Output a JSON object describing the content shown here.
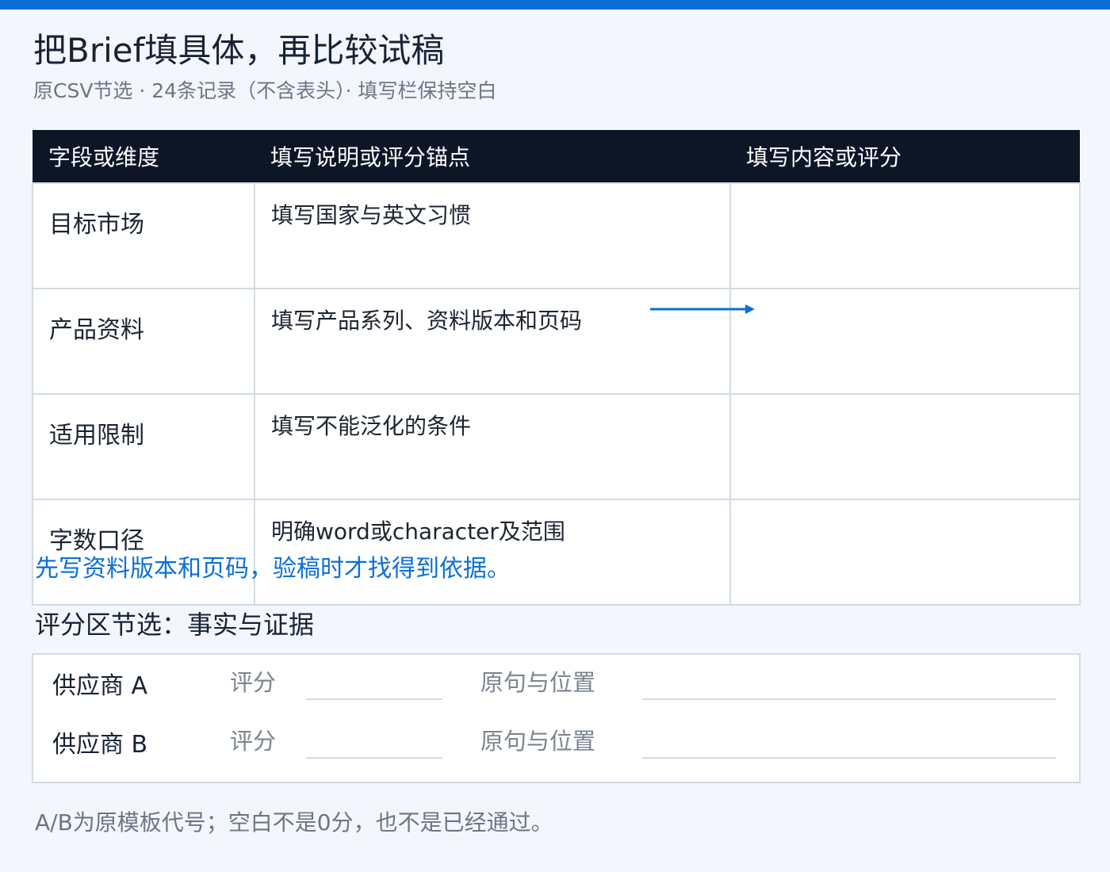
{
  "header": {
    "title": "把Brief填具体，再比较试稿",
    "subtitle": "原CSV节选 · 24条记录（不含表头）· 填写栏保持空白"
  },
  "table": {
    "headers": [
      "字段或维度",
      "填写说明或评分锚点",
      "填写内容或评分"
    ],
    "rows": [
      {
        "field": "目标市场",
        "desc": "填写国家与英文习惯",
        "fill": ""
      },
      {
        "field": "产品资料",
        "desc": "填写产品系列、资料版本和页码",
        "fill": ""
      },
      {
        "field": "适用限制",
        "desc": "填写不能泛化的条件",
        "fill": ""
      },
      {
        "field": "字数口径",
        "desc": "明确word或character及范围",
        "fill": ""
      }
    ]
  },
  "hint": "先写资料版本和页码，验稿时才找得到依据。",
  "scoring": {
    "title": "评分区节选：事实与证据",
    "rows": [
      {
        "vendor": "供应商 A",
        "score_label": "评分",
        "location_label": "原句与位置"
      },
      {
        "vendor": "供应商 B",
        "score_label": "评分",
        "location_label": "原句与位置"
      }
    ]
  },
  "footer": "A/B为原模板代号；空白不是0分，也不是已经通过。",
  "colors": {
    "accent": "#0b6fd6",
    "header_bg": "#0c1627",
    "page_bg": "#f3f7fd",
    "border": "#d3dbe4"
  },
  "icons": {
    "pointer": "arrow-right-icon"
  }
}
